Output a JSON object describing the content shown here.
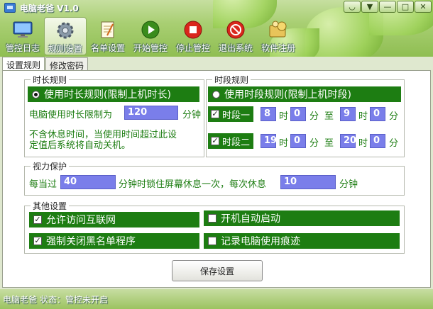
{
  "window": {
    "title": "电脑老爸 V1.0",
    "buttons": [
      "◡",
      "▼",
      "—",
      "□",
      "✕"
    ]
  },
  "toolbar": [
    {
      "label": "管控日志",
      "icon": "monitor-icon"
    },
    {
      "label": "规则设置",
      "icon": "gear-icon"
    },
    {
      "label": "名单设置",
      "icon": "notepad-icon"
    },
    {
      "label": "开始管控",
      "icon": "play-icon"
    },
    {
      "label": "停止管控",
      "icon": "stop-icon"
    },
    {
      "label": "退出系统",
      "icon": "exit-icon"
    },
    {
      "label": "软件注册",
      "icon": "register-icon"
    }
  ],
  "tabs": [
    "设置规则",
    "修改密码"
  ],
  "duration_rule": {
    "title": "时长规则",
    "radio_label": "使用时长规则(限制上机时长)",
    "limit_prefix": "电脑使用时长限制为",
    "limit_value": "120",
    "limit_unit": "分钟",
    "note_line1": "不含休息时间，当使用时间超过此设",
    "note_line2": "定值后系统将自动关机。"
  },
  "period_rule": {
    "title": "时段规则",
    "radio_label": "使用时段规则(限制上机时段)",
    "period1": {
      "label": "时段一",
      "start_hour": "8",
      "start_min": "0",
      "end_hour": "9",
      "end_min": "0"
    },
    "period2": {
      "label": "时段二",
      "start_hour": "19",
      "start_min": "0",
      "end_hour": "20",
      "end_min": "0"
    },
    "hour_unit": "时",
    "min_unit": "分",
    "to": "至"
  },
  "eye_protection": {
    "title": "视力保护",
    "prefix": "每当过",
    "interval": "40",
    "middle": "分钟时锁住屏幕休息一次，每次休息",
    "rest": "10",
    "suffix": "分钟"
  },
  "other_settings": {
    "title": "其他设置",
    "allow_internet": "允许访问互联网",
    "auto_start": "开机自动启动",
    "kill_blacklist": "强制关闭黑名单程序",
    "log_usage": "记录电脑使用痕迹"
  },
  "save_button": "保存设置",
  "status": {
    "app": "电脑老爸",
    "text": "状态：管控未开启"
  },
  "colors": {
    "green_bar": "#1d7d12",
    "field_blue": "#7a7eea",
    "header_green": "#a9cf73"
  }
}
